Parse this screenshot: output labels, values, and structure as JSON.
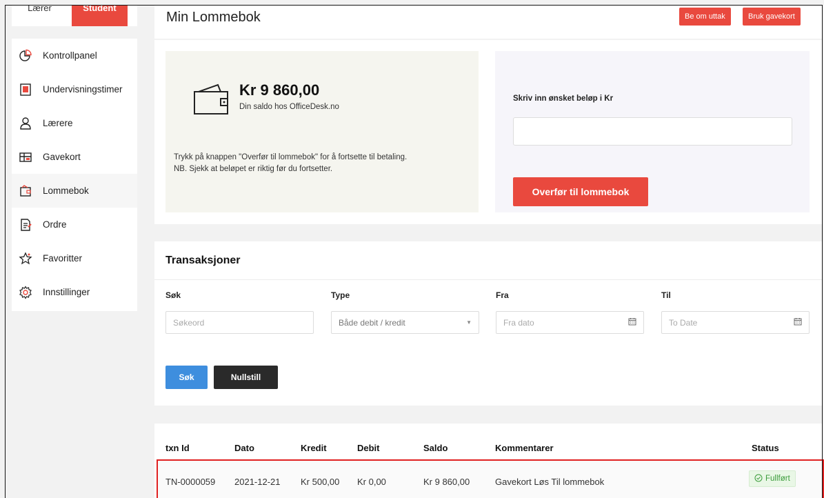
{
  "roles": {
    "teacher": "Lærer",
    "student": "Student"
  },
  "sidebar": {
    "items": [
      {
        "label": "Kontrollpanel",
        "icon": "pie-chart-icon"
      },
      {
        "label": "Undervisningstimer",
        "icon": "document-icon"
      },
      {
        "label": "Lærere",
        "icon": "user-icon"
      },
      {
        "label": "Gavekort",
        "icon": "gift-card-icon"
      },
      {
        "label": "Lommebok",
        "icon": "wallet-icon"
      },
      {
        "label": "Ordre",
        "icon": "order-icon"
      },
      {
        "label": "Favoritter",
        "icon": "star-icon"
      },
      {
        "label": "Innstillinger",
        "icon": "gear-icon"
      }
    ],
    "active_index": 4
  },
  "header": {
    "title": "Min Lommebok",
    "withdraw_label": "Be om uttak",
    "giftcard_label": "Bruk gavekort"
  },
  "wallet": {
    "balance": "Kr 9 860,00",
    "balance_sub": "Din saldo hos OfficeDesk.no",
    "note_line1": "Trykk på knappen \"Overfør til lommebok\" for å fortsette til betaling.",
    "note_line2": "NB. Sjekk at beløpet er riktig før du fortsetter."
  },
  "transfer": {
    "amount_label": "Skriv inn ønsket beløp i Kr",
    "amount_value": "",
    "button_label": "Overfør til lommebok"
  },
  "transactions": {
    "title": "Transaksjoner",
    "filters": {
      "search_label": "Søk",
      "search_placeholder": "Søkeord",
      "type_label": "Type",
      "type_value": "Både debit / kredit",
      "from_label": "Fra",
      "from_placeholder": "Fra dato",
      "to_label": "Til",
      "to_placeholder": "To Date"
    },
    "search_button": "Søk",
    "reset_button": "Nullstill",
    "columns": [
      "txn Id",
      "Dato",
      "Kredit",
      "Debit",
      "Saldo",
      "Kommentarer",
      "Status"
    ],
    "rows": [
      {
        "txn_id": "TN-0000059",
        "date": "2021-12-21",
        "credit": "Kr 500,00",
        "debit": "Kr 0,00",
        "balance": "Kr 9 860,00",
        "comment": "Gavekort Løs Til lommebok",
        "status": "Fullført"
      }
    ]
  },
  "colors": {
    "accent": "#e9493e",
    "primary_blue": "#3e8ede",
    "success": "#3a9b3a"
  }
}
